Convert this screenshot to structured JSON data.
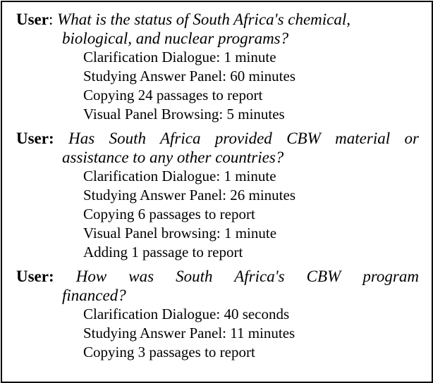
{
  "sessions": [
    {
      "speaker": "User",
      "separator": ":",
      "question_line1": "What is the status of South Africa's chemical,",
      "question_line2": "biological, and nuclear programs?",
      "steps": [
        "Clarification Dialogue: 1 minute",
        "Studying Answer Panel: 60 minutes",
        "Copying 24 passages to report",
        "Visual Panel Browsing: 5 minutes"
      ]
    },
    {
      "speaker": "User:",
      "question_line1": "Has South Africa provided CBW material or",
      "question_line2": "assistance to any other countries?",
      "steps": [
        "Clarification Dialogue: 1 minute",
        "Studying Answer Panel: 26 minutes",
        "Copying 6 passages to report",
        "Visual Panel browsing: 1 minute",
        "Adding 1 passage to report"
      ]
    },
    {
      "speaker": "User:",
      "question_line1": "How was South Africa's CBW program",
      "question_line2": "financed?",
      "steps": [
        "Clarification Dialogue: 40 seconds",
        "Studying Answer Panel: 11 minutes",
        "Copying 3 passages to report"
      ]
    }
  ]
}
